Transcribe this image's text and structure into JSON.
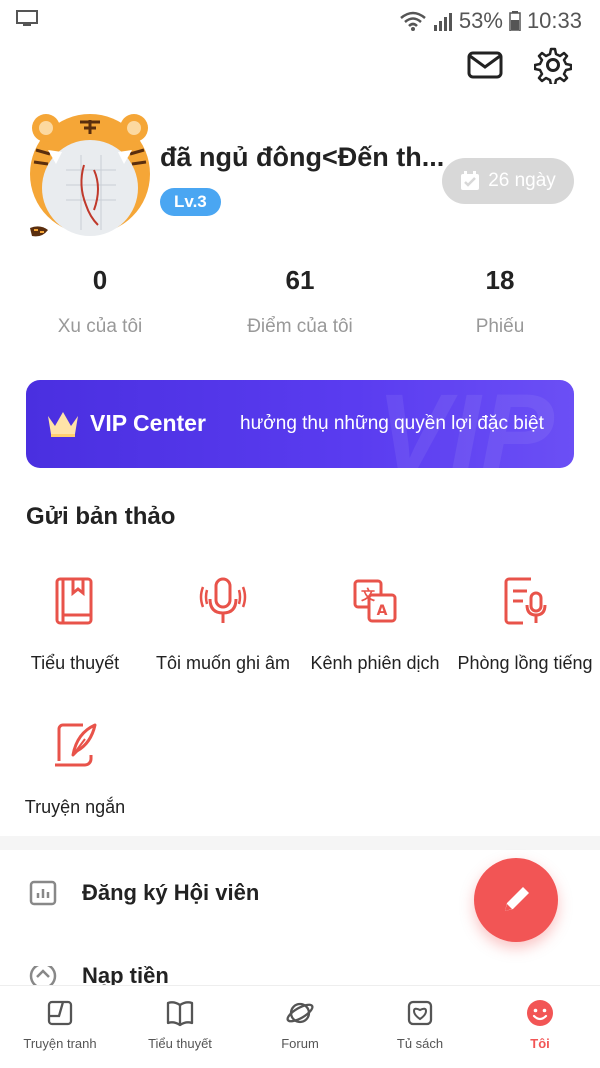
{
  "status_bar": {
    "battery": "53%",
    "time": "10:33"
  },
  "profile": {
    "username": "đã ngủ đông<Đến th...",
    "level": "Lv.3",
    "checkin_label": "26 ngày"
  },
  "stats": [
    {
      "value": "0",
      "label": "Xu của tôi"
    },
    {
      "value": "61",
      "label": "Điểm của tôi"
    },
    {
      "value": "18",
      "label": "Phiếu"
    }
  ],
  "vip": {
    "title": "VIP Center",
    "subtitle": "hưởng thụ những quyền lợi đặc biệt",
    "watermark": "VIP"
  },
  "submit": {
    "title": "Gửi bản thảo",
    "items": [
      {
        "label": "Tiểu thuyết",
        "icon": "book-icon"
      },
      {
        "label": "Tôi muốn ghi âm",
        "icon": "microphone-icon"
      },
      {
        "label": "Kênh phiên dịch",
        "icon": "translate-icon"
      },
      {
        "label": "Phòng lồng tiếng",
        "icon": "dubbing-icon"
      },
      {
        "label": "Truyện ngắn",
        "icon": "quill-icon"
      }
    ]
  },
  "menu": [
    {
      "label": "Đăng ký Hội viên",
      "icon": "membership-chart-icon"
    },
    {
      "label": "Nạp tiền",
      "icon": "recharge-icon"
    }
  ],
  "bottom_nav": [
    {
      "label": "Truyện tranh",
      "icon": "comic-icon"
    },
    {
      "label": "Tiểu thuyết",
      "icon": "novel-book-icon"
    },
    {
      "label": "Forum",
      "icon": "forum-planet-icon"
    },
    {
      "label": "Tủ sách",
      "icon": "bookshelf-icon"
    },
    {
      "label": "Tôi",
      "icon": "me-face-icon",
      "active": true
    }
  ],
  "colors": {
    "accent": "#f25555",
    "vip_bg": "#4a2fe0",
    "level_badge": "#4aa6f2",
    "icon_red": "#e8534a"
  }
}
